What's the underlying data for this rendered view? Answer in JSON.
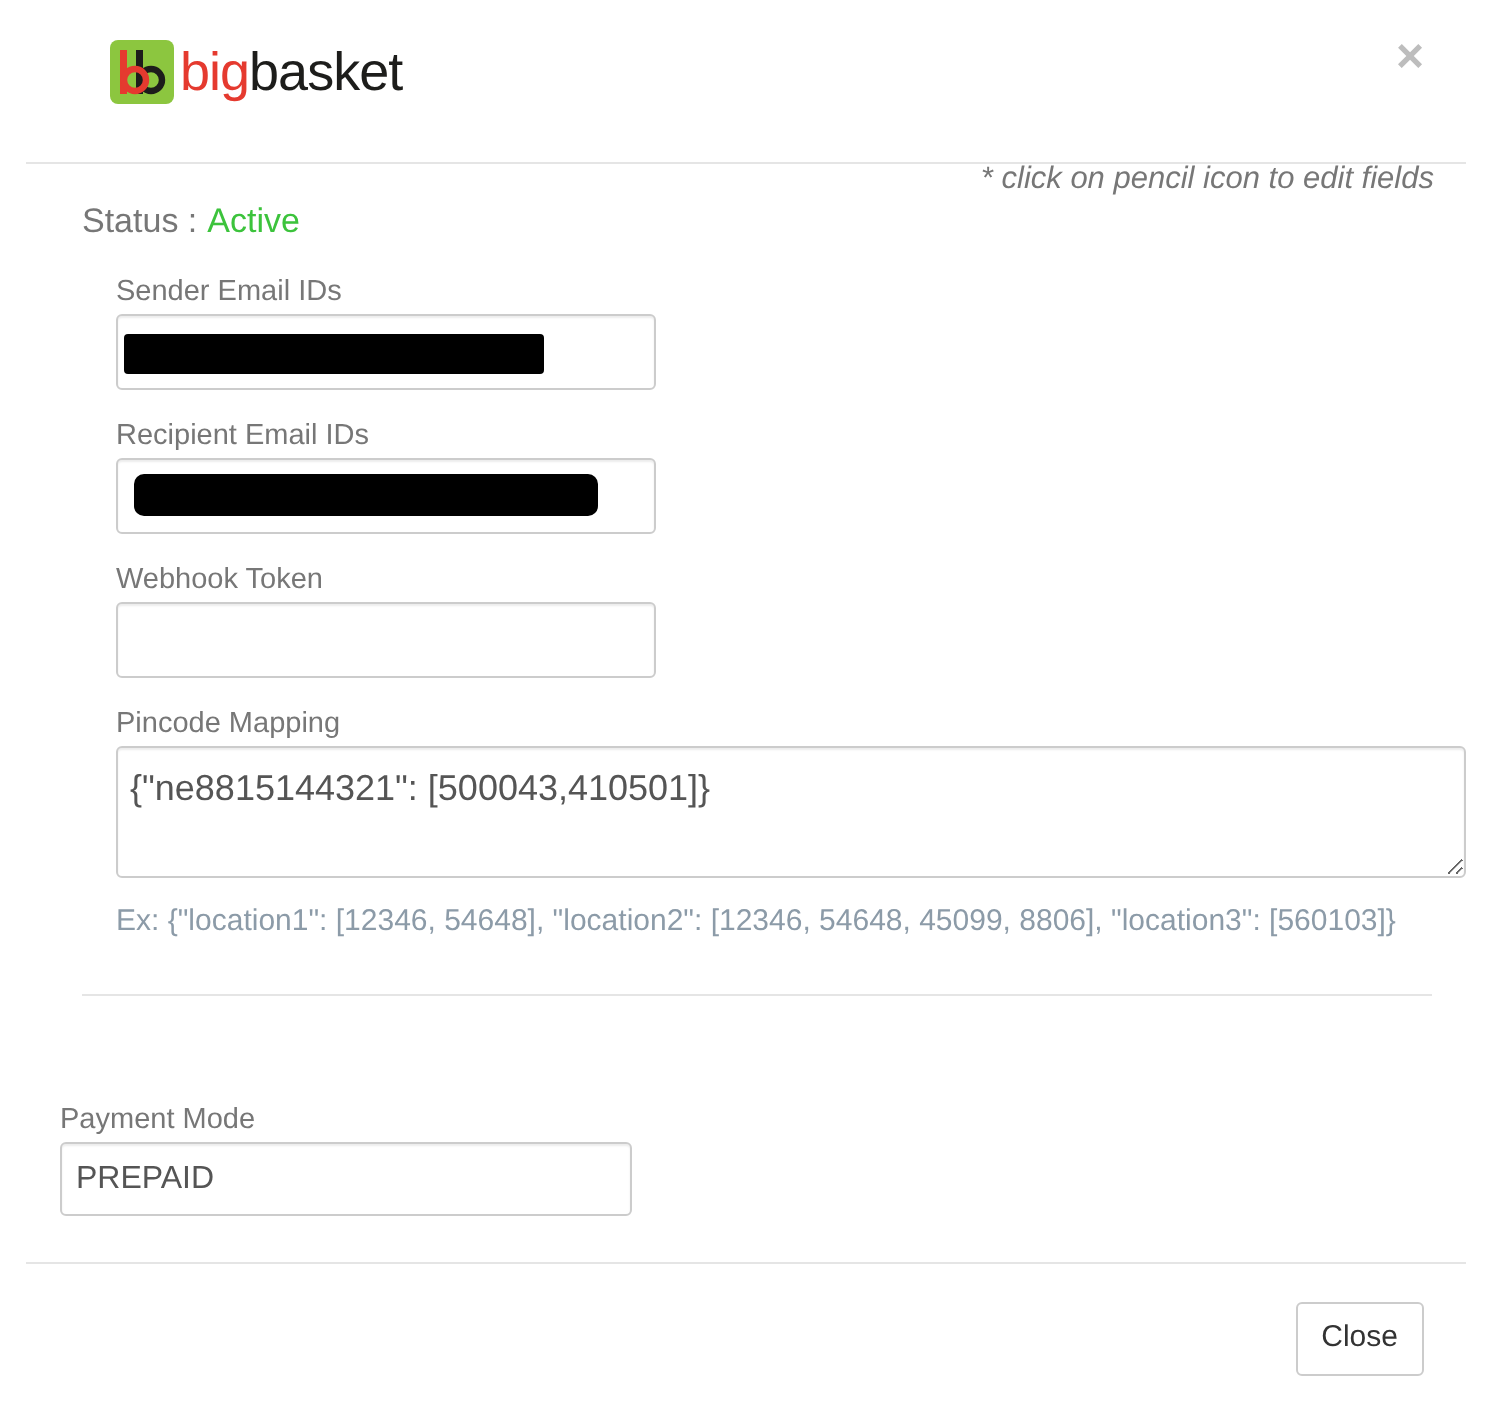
{
  "logo": {
    "accent": "big",
    "text": "basket"
  },
  "close": "×",
  "hint": "* click on pencil icon to edit fields",
  "status": {
    "label": "Status :",
    "value": "Active",
    "active": true
  },
  "fields": [
    {
      "kind": "input",
      "label": "Sender Email IDs",
      "redacted": true
    },
    {
      "kind": "input",
      "label": "Recipient Email IDs",
      "redacted": true
    },
    {
      "kind": "input",
      "label": "Webhook Token",
      "redacted": false
    },
    {
      "kind": "textarea",
      "label": "Pincode Mapping",
      "value": "{\"ne8815144321\": [500043,410501]}",
      "redacted": false,
      "help": "Ex: {\"location1\": [12346, 54648], \"location2\": [12346, 54648, 45099, 8806], \"location3\": [560103]}"
    }
  ],
  "payment_mode": {
    "label": "Payment Mode",
    "value": "PREPAID"
  },
  "buttons": [
    "Close"
  ]
}
